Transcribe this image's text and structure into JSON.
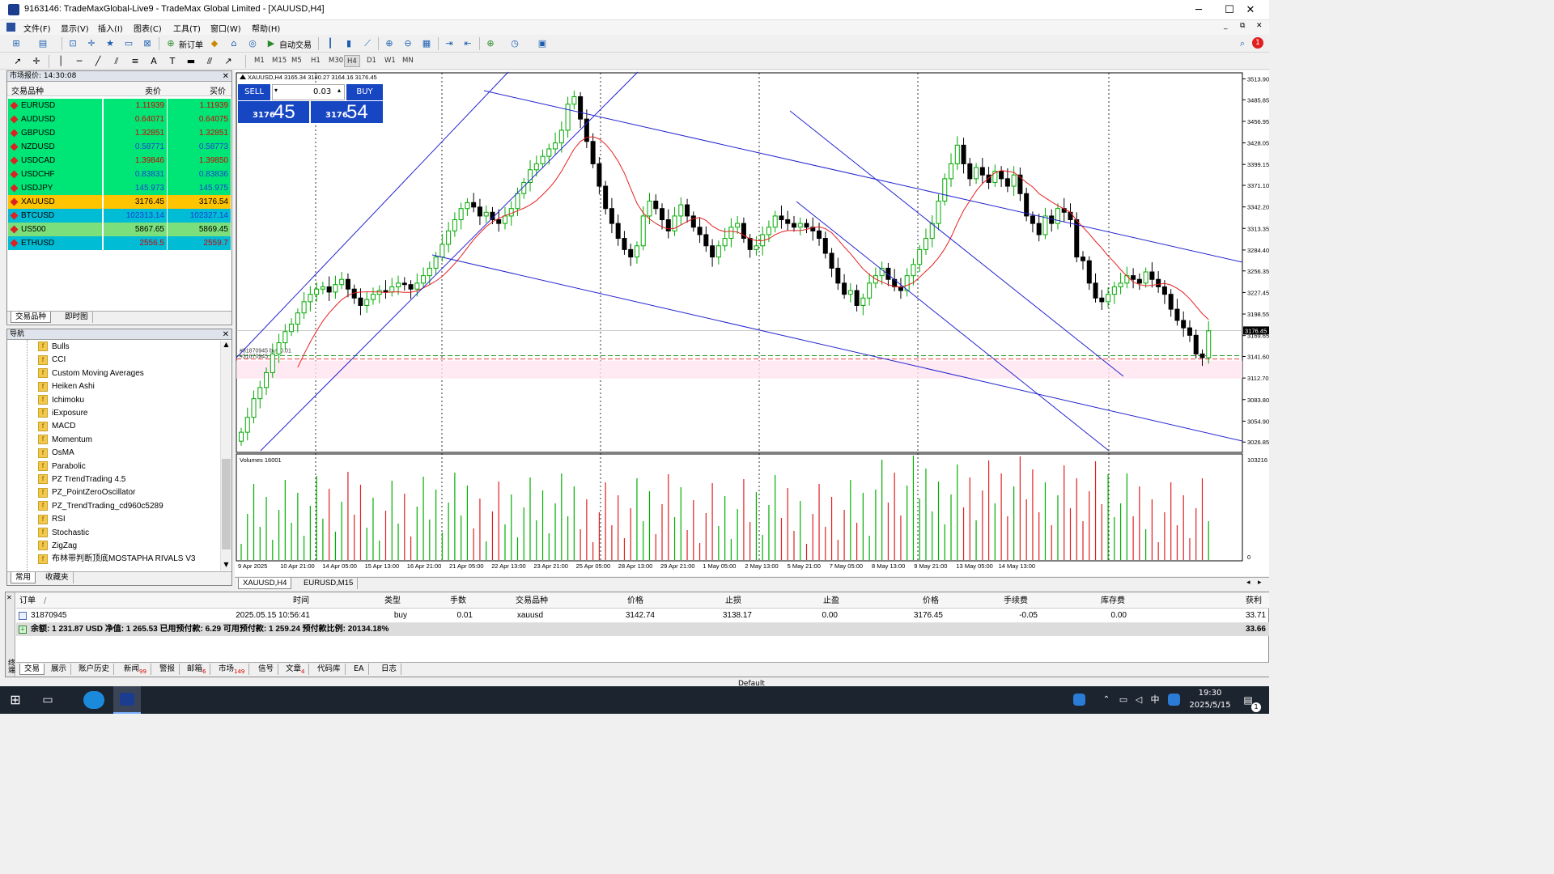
{
  "window": {
    "title": "9163146: TradeMaxGlobal-Live9 - TradeMax Global Limited - [XAUUSD,H4]",
    "minimize": "─",
    "maximize": "☐",
    "close": "✕"
  },
  "menu": [
    "文件(F)",
    "显示(V)",
    "插入(I)",
    "图表(C)",
    "工具(T)",
    "窗口(W)",
    "帮助(H)"
  ],
  "toolbar": {
    "new_order": "新订单",
    "auto_trading": "自动交易",
    "timeframes": [
      "M1",
      "M15",
      "M5",
      "H1",
      "M30",
      "H4",
      "D1",
      "W1",
      "MN"
    ],
    "active_timeframe": "H4",
    "notification_count": "1"
  },
  "market_watch": {
    "title": "市场报价: 14:30:08",
    "col_symbol": "交易品种",
    "col_bid": "卖价",
    "col_ask": "买价",
    "rows": [
      {
        "symbol": "EURUSD",
        "bid": "1.11939",
        "ask": "1.11939",
        "bg": "#00e676",
        "color": "#d40000"
      },
      {
        "symbol": "AUDUSD",
        "bid": "0.64071",
        "ask": "0.64075",
        "bg": "#00e676",
        "color": "#d40000"
      },
      {
        "symbol": "GBPUSD",
        "bid": "1.32851",
        "ask": "1.32851",
        "bg": "#00e676",
        "color": "#d40000"
      },
      {
        "symbol": "NZDUSD",
        "bid": "0.58771",
        "ask": "0.58773",
        "bg": "#00e676",
        "color": "#1a3fd6"
      },
      {
        "symbol": "USDCAD",
        "bid": "1.39846",
        "ask": "1.39850",
        "bg": "#00e676",
        "color": "#d40000"
      },
      {
        "symbol": "USDCHF",
        "bid": "0.83831",
        "ask": "0.83836",
        "bg": "#00e676",
        "color": "#1a3fd6"
      },
      {
        "symbol": "USDJPY",
        "bid": "145.973",
        "ask": "145.975",
        "bg": "#00e676",
        "color": "#1a3fd6"
      },
      {
        "symbol": "XAUUSD",
        "bid": "3176.45",
        "ask": "3176.54",
        "bg": "#ffc400",
        "color": "#000000"
      },
      {
        "symbol": "BTCUSD",
        "bid": "102313.14",
        "ask": "102327.14",
        "bg": "#00bcd4",
        "color": "#1a3fd6"
      },
      {
        "symbol": "US500",
        "bid": "5867.65",
        "ask": "5869.45",
        "bg": "#7be07b",
        "color": "#000000"
      },
      {
        "symbol": "ETHUSD",
        "bid": "2556.5",
        "ask": "2559.7",
        "bg": "#00bcd4",
        "color": "#d40000"
      }
    ],
    "tabs": [
      "交易品种",
      "即时图"
    ]
  },
  "navigator": {
    "title": "导航",
    "items": [
      "Bulls",
      "CCI",
      "Custom Moving Averages",
      "Heiken Ashi",
      "Ichimoku",
      "iExposure",
      "MACD",
      "Momentum",
      "OsMA",
      "Parabolic",
      "PZ TrendTrading 4.5",
      "PZ_PointZeroOscillator",
      "PZ_TrendTrading_cd960c5289",
      "RSI",
      "Stochastic",
      "ZigZag",
      "布林带判断顶底MOSTAPHA RIVALS V3"
    ],
    "tabs": [
      "常用",
      "收藏夹"
    ]
  },
  "chart": {
    "info": "XAUUSD,H4  3165.34 3180.27 3164.16 3176.45",
    "one_click": {
      "sell_label": "SELL",
      "buy_label": "BUY",
      "lot": "0.03",
      "sell_big": "45",
      "sell_small": "3176",
      "buy_big": "54",
      "buy_small": "3176"
    },
    "order_label": "#31870945 buy 0.01",
    "order_label2": "#31870945",
    "current_price_label": "3176.45",
    "volume_label": "Volumes 16001",
    "volume_max_label": "103216",
    "volume_zero_label": "0",
    "tabs": [
      "XAUUSD,H4",
      "EURUSD,M15"
    ],
    "colors": {
      "bull": "#00aa00",
      "bear": "#000000",
      "ma": "#e82020",
      "channel": "#2424d0",
      "volume_up": "#00b000",
      "volume_down": "#e02020"
    }
  },
  "chart_data": {
    "type": "candlestick",
    "symbol": "XAUUSD",
    "timeframe": "H4",
    "ylim": [
      3013,
      3522
    ],
    "yticks": [
      "3513.90",
      "3485.85",
      "3456.95",
      "3428.05",
      "3399.15",
      "3371.10",
      "3342.20",
      "3313.35",
      "3284.40",
      "3256.35",
      "3227.45",
      "3198.55",
      "3169.65",
      "3141.60",
      "3112.70",
      "3083.80",
      "3054.90",
      "3026.85"
    ],
    "xticks": [
      "9 Apr 2025",
      "10 Apr 21:00",
      "14 Apr 05:00",
      "15 Apr 13:00",
      "16 Apr 21:00",
      "21 Apr 05:00",
      "22 Apr 13:00",
      "23 Apr 21:00",
      "25 Apr 05:00",
      "28 Apr 13:00",
      "29 Apr 21:00",
      "1 May 05:00",
      "2 May 13:00",
      "5 May 21:00",
      "7 May 05:00",
      "8 May 13:00",
      "9 May 21:00",
      "13 May 05:00",
      "14 May 13:00"
    ],
    "close": [
      3040,
      3060,
      3085,
      3100,
      3120,
      3145,
      3160,
      3175,
      3185,
      3200,
      3215,
      3225,
      3232,
      3235,
      3228,
      3238,
      3245,
      3232,
      3220,
      3210,
      3218,
      3225,
      3230,
      3228,
      3235,
      3240,
      3238,
      3232,
      3240,
      3250,
      3260,
      3275,
      3292,
      3310,
      3325,
      3340,
      3348,
      3342,
      3330,
      3335,
      3325,
      3320,
      3330,
      3340,
      3360,
      3375,
      3392,
      3400,
      3410,
      3420,
      3428,
      3445,
      3480,
      3490,
      3460,
      3430,
      3400,
      3370,
      3340,
      3320,
      3300,
      3285,
      3275,
      3290,
      3330,
      3350,
      3340,
      3325,
      3310,
      3330,
      3345,
      3330,
      3315,
      3305,
      3290,
      3275,
      3290,
      3300,
      3315,
      3320,
      3300,
      3285,
      3290,
      3305,
      3315,
      3330,
      3325,
      3320,
      3315,
      3320,
      3315,
      3310,
      3300,
      3280,
      3260,
      3240,
      3225,
      3230,
      3210,
      3220,
      3240,
      3250,
      3260,
      3245,
      3235,
      3230,
      3250,
      3265,
      3285,
      3300,
      3320,
      3350,
      3380,
      3400,
      3425,
      3400,
      3380,
      3395,
      3385,
      3375,
      3390,
      3380,
      3370,
      3385,
      3360,
      3330,
      3320,
      3305,
      3330,
      3320,
      3340,
      3335,
      3325,
      3275,
      3270,
      3240,
      3220,
      3215,
      3225,
      3235,
      3240,
      3250,
      3245,
      3240,
      3255,
      3245,
      3235,
      3225,
      3205,
      3190,
      3180,
      3170,
      3145,
      3140,
      3176
    ]
  },
  "terminal": {
    "headers": [
      "订单",
      "/",
      "时间",
      "类型",
      "手数",
      "交易品种",
      "价格",
      "止损",
      "止盈",
      "价格",
      "手续费",
      "库存费",
      "获利"
    ],
    "order": {
      "id": "31870945",
      "time": "2025.05.15 10:56:41",
      "type": "buy",
      "lots": "0.01",
      "symbol": "xauusd",
      "open_price": "3142.74",
      "sl": "3138.17",
      "tp": "0.00",
      "price": "3176.45",
      "commission": "-0.05",
      "swap": "0.00",
      "profit": "33.71"
    },
    "summary": "余额: 1 231.87 USD  净值: 1 265.53  已用预付款: 6.29  可用预付款: 1 259.24  预付款比例: 20134.18%",
    "summary_profit": "33.66",
    "tabs": [
      {
        "label": "交易",
        "badge": ""
      },
      {
        "label": "展示",
        "badge": ""
      },
      {
        "label": "账户历史",
        "badge": ""
      },
      {
        "label": "新闻",
        "badge": "99"
      },
      {
        "label": "警报",
        "badge": ""
      },
      {
        "label": "邮箱",
        "badge": "6"
      },
      {
        "label": "市场",
        "badge": "149"
      },
      {
        "label": "信号",
        "badge": ""
      },
      {
        "label": "文章",
        "badge": "4"
      },
      {
        "label": "代码库",
        "badge": ""
      },
      {
        "label": "EA",
        "badge": ""
      },
      {
        "label": "日志",
        "badge": ""
      }
    ],
    "side_label": "终端"
  },
  "status": {
    "profile": "Default"
  },
  "taskbar": {
    "time": "19:30",
    "date": "2025/5/15",
    "ime": "中",
    "notify": "1"
  }
}
